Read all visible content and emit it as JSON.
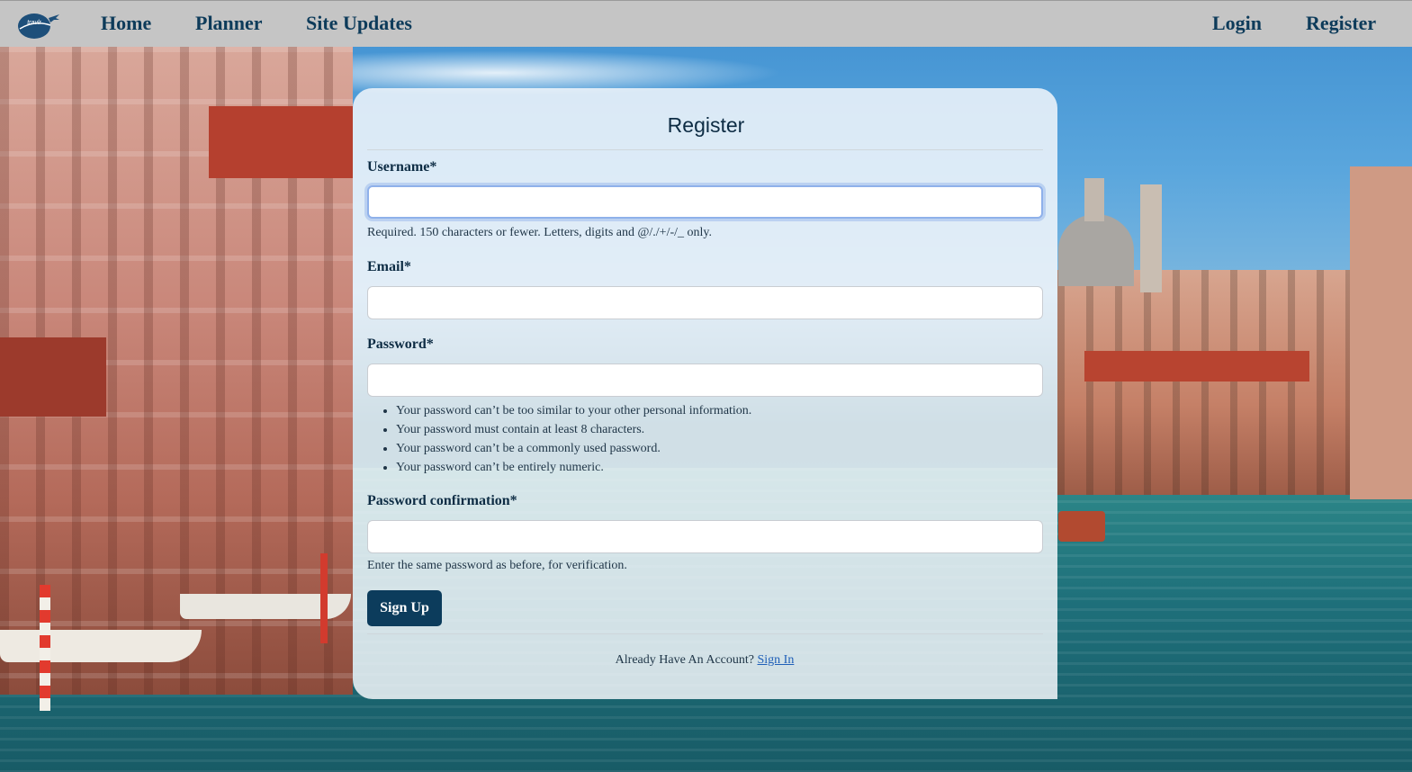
{
  "navbar": {
    "logo_text": "travlr",
    "links": {
      "home": "Home",
      "planner": "Planner",
      "site_updates": "Site Updates",
      "login": "Login",
      "register": "Register"
    }
  },
  "form": {
    "title": "Register",
    "username": {
      "label": "Username*",
      "value": "",
      "help": "Required. 150 characters or fewer. Letters, digits and @/./+/-/_ only."
    },
    "email": {
      "label": "Email*",
      "value": ""
    },
    "password": {
      "label": "Password*",
      "value": "",
      "rules": [
        "Your password can’t be too similar to your other personal information.",
        "Your password must contain at least 8 characters.",
        "Your password can’t be a commonly used password.",
        "Your password can’t be entirely numeric."
      ]
    },
    "password_confirmation": {
      "label": "Password confirmation*",
      "value": "",
      "help": "Enter the same password as before, for verification."
    },
    "submit_label": "Sign Up",
    "account_prompt": "Already Have An Account?",
    "signin_link": "Sign In"
  },
  "colors": {
    "navbar_bg": "#c5c5c5",
    "nav_text": "#0d3b5a",
    "primary_button": "#0c3c5c",
    "link": "#1f5fb8"
  },
  "background": {
    "description_icon": "venice-canal-photo"
  }
}
